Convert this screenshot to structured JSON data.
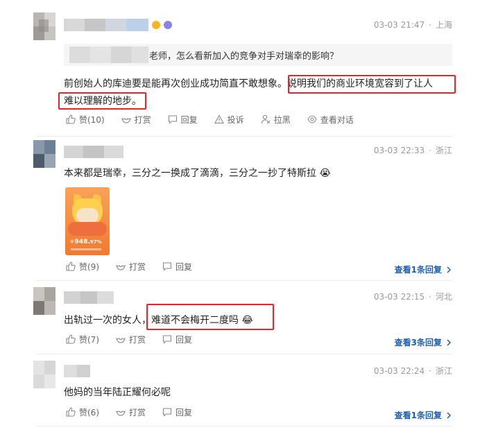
{
  "comments": [
    {
      "time": "03-03 21:47",
      "location": "上海",
      "quote_text": "老师，怎么看新加入的竞争对手对瑞幸的影响？",
      "text_line1_plain": "前创始人的库迪要是能再次创业成功简直不敢想象。",
      "text_line1_highlight": "说明我们的商业环境宽容到了让人",
      "text_line2_highlight": "难以理解的地步。",
      "actions": [
        "赞(10)",
        "打赏",
        "回复",
        "投诉",
        "拉黑",
        "查看对话"
      ]
    },
    {
      "time": "03-03 22:33",
      "location": "浙江",
      "text": "本来都是瑞幸，三分之一换成了滴滴，三分之一抄了特斯拉",
      "emoji": "😭",
      "image_number": "+948.",
      "image_number_small": "97%",
      "actions": [
        "赞(9)",
        "打赏",
        "回复"
      ],
      "replies": "查看1条回复"
    },
    {
      "time": "03-03 22:15",
      "location": "河北",
      "text_plain": "出轨过一次的女人，",
      "text_highlight": "难道不会梅开二度吗",
      "emoji": "😂",
      "actions": [
        "赞(7)",
        "打赏",
        "回复"
      ],
      "replies": "查看3条回复"
    },
    {
      "time": "03-03 22:24",
      "location": "浙江",
      "text": "他妈的当年陆正耀何必呢",
      "actions": [
        "赞(6)",
        "打赏",
        "回复"
      ],
      "replies": "查看1条回复"
    }
  ],
  "colors": {
    "highlight": "#e8232a",
    "link": "#1f5fb0",
    "meta": "#999999"
  }
}
